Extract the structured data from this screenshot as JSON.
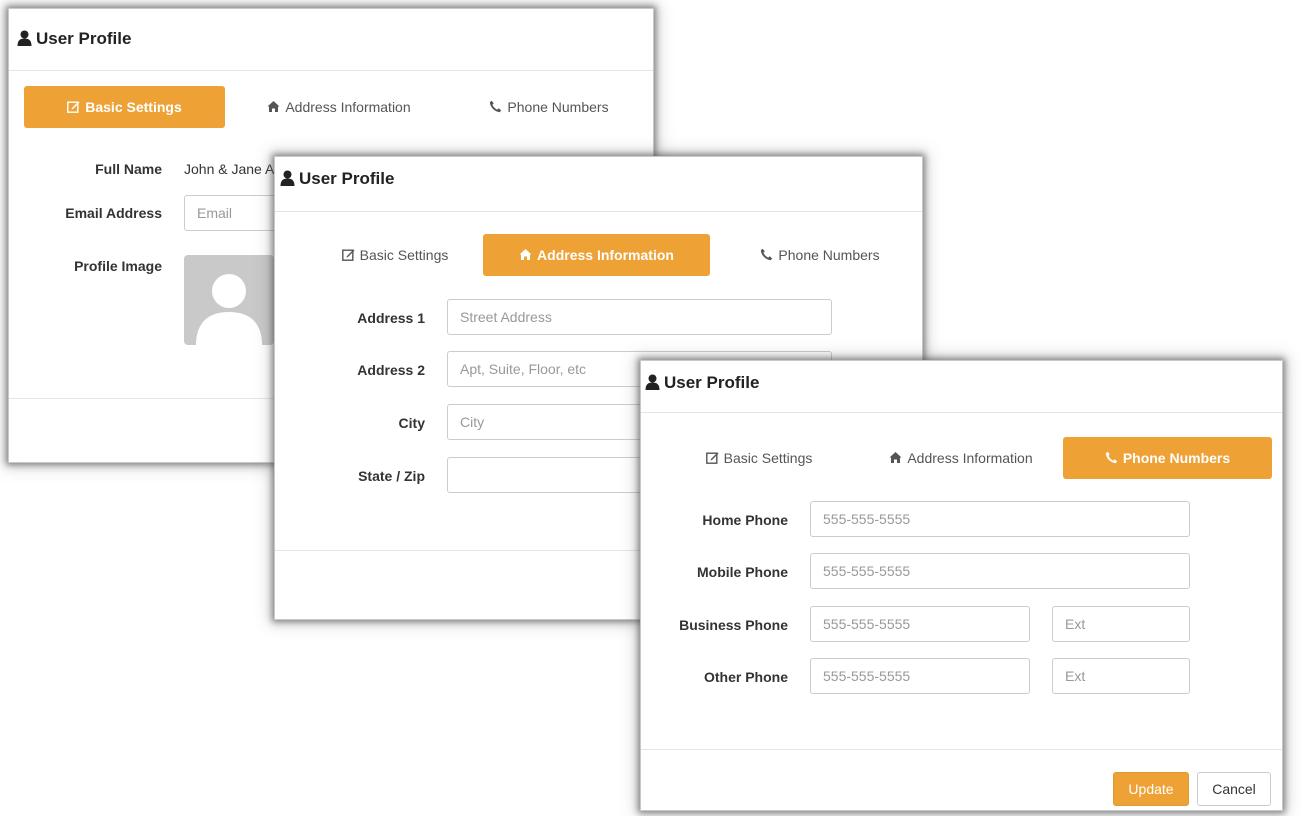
{
  "panel1": {
    "title": "User Profile",
    "tabs": [
      {
        "label": "Basic Settings",
        "icon": "edit-icon",
        "active": true
      },
      {
        "label": "Address Information",
        "icon": "home-icon",
        "active": false
      },
      {
        "label": "Phone Numbers",
        "icon": "phone-icon",
        "active": false
      }
    ],
    "full_name_label": "Full Name",
    "full_name_value": "John & Jane A",
    "email_label": "Email Address",
    "email_placeholder": "Email",
    "profile_image_label": "Profile Image"
  },
  "panel2": {
    "title": "User Profile",
    "tabs": [
      {
        "label": "Basic Settings",
        "icon": "edit-icon",
        "active": false
      },
      {
        "label": "Address Information",
        "icon": "home-icon",
        "active": true
      },
      {
        "label": "Phone Numbers",
        "icon": "phone-icon",
        "active": false
      }
    ],
    "address1_label": "Address 1",
    "address1_placeholder": "Street Address",
    "address2_label": "Address 2",
    "address2_placeholder": "Apt, Suite, Floor, etc",
    "city_label": "City",
    "city_placeholder": "City",
    "state_zip_label": "State / Zip"
  },
  "panel3": {
    "title": "User Profile",
    "tabs": [
      {
        "label": "Basic Settings",
        "icon": "edit-icon",
        "active": false
      },
      {
        "label": "Address Information",
        "icon": "home-icon",
        "active": false
      },
      {
        "label": "Phone Numbers",
        "icon": "phone-icon",
        "active": true
      }
    ],
    "home_phone_label": "Home Phone",
    "home_phone_placeholder": "555-555-5555",
    "mobile_phone_label": "Mobile Phone",
    "mobile_phone_placeholder": "555-555-5555",
    "business_phone_label": "Business Phone",
    "business_phone_placeholder": "555-555-5555",
    "business_ext_placeholder": "Ext",
    "other_phone_label": "Other Phone",
    "other_phone_placeholder": "555-555-5555",
    "other_ext_placeholder": "Ext",
    "update_label": "Update",
    "cancel_label": "Cancel"
  },
  "colors": {
    "accent": "#eea236",
    "border": "#cccccc",
    "text": "#333333",
    "placeholder": "#999999"
  }
}
